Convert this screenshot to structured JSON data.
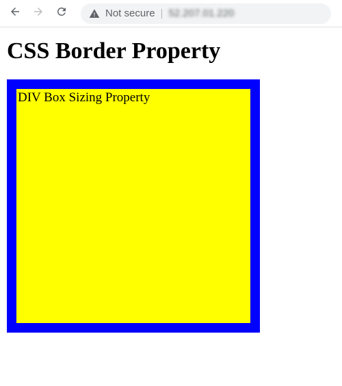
{
  "browser": {
    "not_secure_label": "Not secure",
    "divider": "|",
    "url_text": "52.207.01.220"
  },
  "page": {
    "title": "CSS Border Property",
    "box_text": "DIV Box Sizing Property"
  },
  "colors": {
    "border": "#0000ff",
    "background": "#ffff00"
  }
}
